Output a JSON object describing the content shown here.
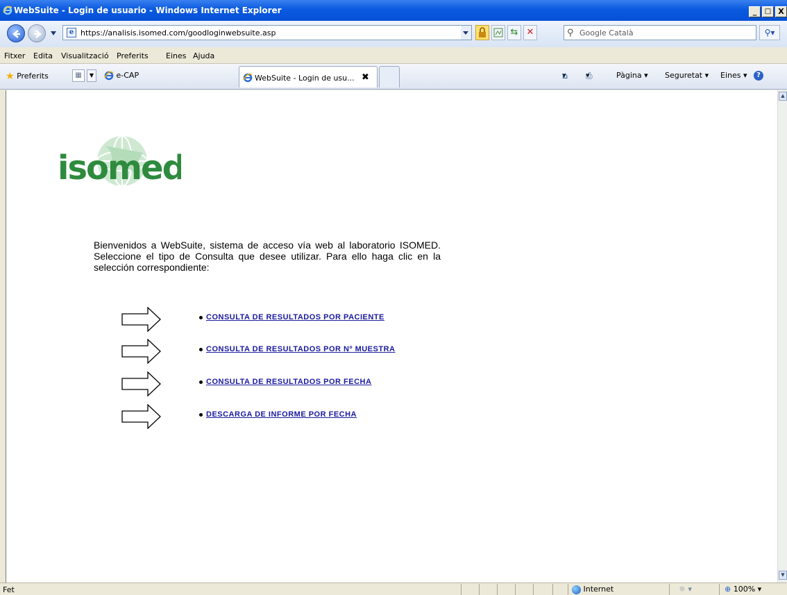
{
  "window": {
    "title": "WebSuite - Login de usuario - Windows Internet Explorer",
    "minimize": "_",
    "maximize": "□",
    "close": "X"
  },
  "address": {
    "url": "https://analisis.isomed.com/goodloginwebsuite.asp",
    "search_placeholder": "Google Català"
  },
  "menu": [
    "Fitxer",
    "Edita",
    "Visualització",
    "Preferits",
    "Eines",
    "Ajuda"
  ],
  "favorites": {
    "label": "Preferits",
    "link": "e-CAP"
  },
  "tab": {
    "label": "WebSuite - Login de usu...",
    "close": "✖"
  },
  "commandbar": {
    "page": "Pàgina ▾",
    "security": "Seguretat ▾",
    "tools": "Eines ▾"
  },
  "page": {
    "logo_text": "isomed",
    "welcome": "Bienvenidos a WebSuite, sistema de acceso vía web al laboratorio ISOMED. Seleccione el tipo de Consulta que desee utilizar. Para ello haga clic en la selección correspondiente:",
    "options": [
      "CONSULTA DE RESULTADOS POR PACIENTE",
      "CONSULTA DE RESULTADOS POR Nº MUESTRA",
      "CONSULTA DE RESULTADOS POR FECHA",
      "DESCARGA DE INFORME POR FECHA"
    ]
  },
  "status": {
    "text": "Fet",
    "zone": "Internet",
    "zoom": "100%"
  },
  "colors": {
    "logo_green": "#2e8b3e",
    "link": "#1a1aa0",
    "titlebar": "#0a5adf"
  }
}
